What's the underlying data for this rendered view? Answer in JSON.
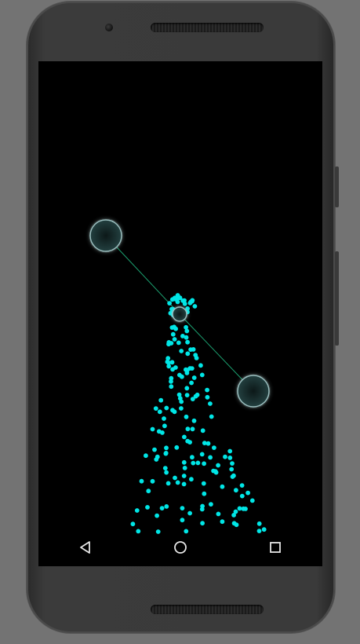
{
  "colors": {
    "background": "#737373",
    "phone_body": "#3a3a3a",
    "screen": "#000000",
    "particle": "#00e6e6",
    "joint_fill": "#1f3434",
    "joint_ring": "#9bbfbf",
    "tether": "#1ca070",
    "nav_icon": "#e6e6e6"
  },
  "icons": {
    "nav_back": "triangle-back-icon",
    "nav_home": "circle-home-icon",
    "nav_recents": "square-recents-icon"
  },
  "scene": {
    "joints": [
      "left-handle",
      "center-hub",
      "right-handle"
    ],
    "particle_effect": "cyan-fountain"
  }
}
